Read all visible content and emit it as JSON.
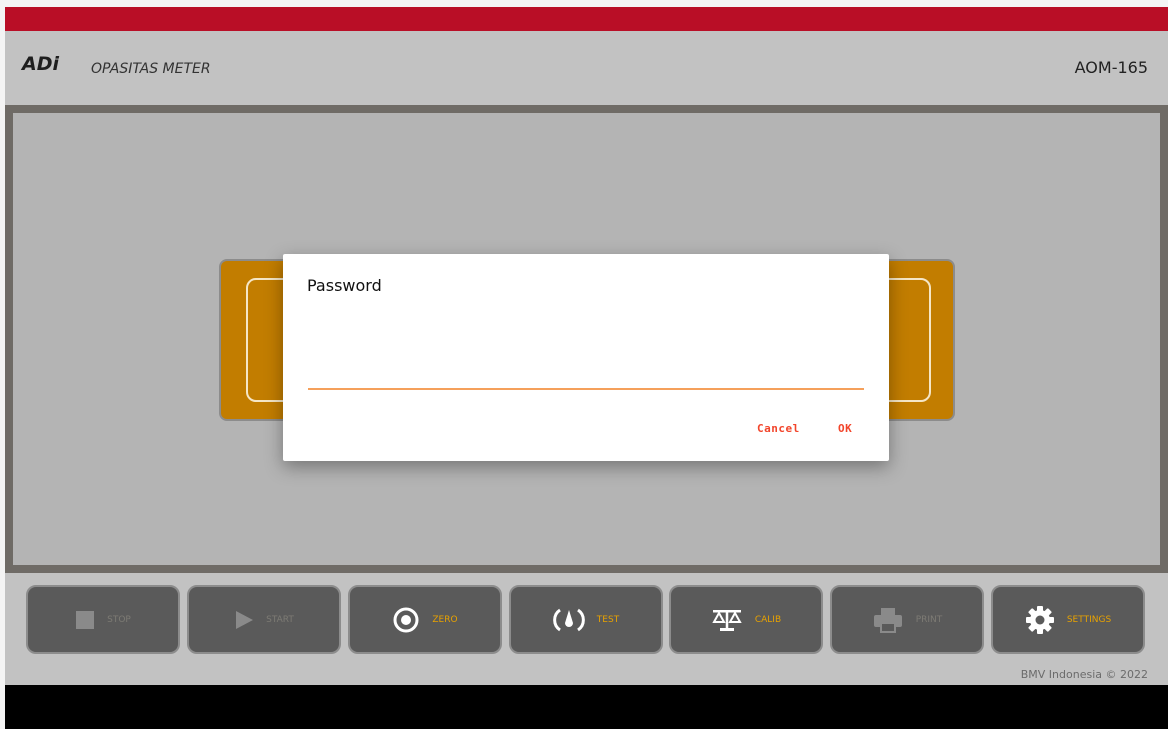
{
  "header": {
    "brand": "ADi",
    "subtitle": "OPASITAS METER",
    "model": "AOM-165"
  },
  "dialog": {
    "title": "Password",
    "password_value": "",
    "cancel_label": "Cancel",
    "ok_label": "OK"
  },
  "toolbar": [
    {
      "label": "STOP",
      "icon": "stop-icon",
      "enabled": false
    },
    {
      "label": "START",
      "icon": "play-icon",
      "enabled": false
    },
    {
      "label": "ZERO",
      "icon": "zero-icon",
      "enabled": true
    },
    {
      "label": "TEST",
      "icon": "test-icon",
      "enabled": true
    },
    {
      "label": "CALIB",
      "icon": "balance-scale-icon",
      "enabled": true
    },
    {
      "label": "PRINT",
      "icon": "printer-icon",
      "enabled": false
    },
    {
      "label": "SETTINGS",
      "icon": "gear-icon",
      "enabled": true
    }
  ],
  "footer": {
    "copyright": "BMV Indonesia © 2022"
  },
  "colors": {
    "topbar": "#b90e26",
    "accent": "#e8a200",
    "dialog_button": "#f2452b",
    "input_underline": "#f5a05b",
    "card": "#c27d00"
  }
}
